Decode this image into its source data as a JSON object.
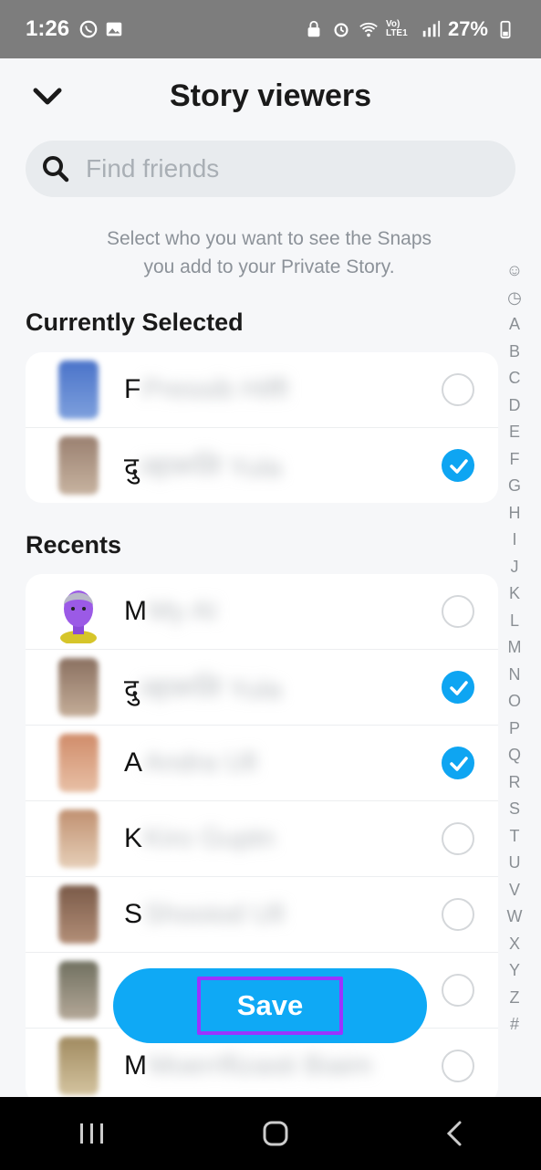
{
  "status": {
    "time": "1:26",
    "battery": "27%",
    "network_label": "Vo) LTE1"
  },
  "header": {
    "title": "Story viewers",
    "back_icon": "chevron-down-icon"
  },
  "search": {
    "placeholder": "Find friends"
  },
  "hint": {
    "line1": "Select who you want to see the Snaps",
    "line2": "you add to your Private Story."
  },
  "currently_selected": {
    "title": "Currently Selected",
    "items": [
      {
        "initial": "F",
        "rest": "Pressib Hiffl",
        "checked": false
      },
      {
        "initial": "दु",
        "rest": "ल्हारूलि Yula",
        "checked": true
      }
    ]
  },
  "recents": {
    "title": "Recents",
    "items": [
      {
        "initial": "M",
        "rest": "My AI",
        "checked": false
      },
      {
        "initial": "दु",
        "rest": "ल्हारूलि Yula",
        "checked": true
      },
      {
        "initial": "A",
        "rest": "Andra Ull",
        "checked": true
      },
      {
        "initial": "K",
        "rest": "Kiro Guptn",
        "checked": false
      },
      {
        "initial": "S",
        "rest": "Shooiod Ull",
        "checked": false
      },
      {
        "initial": "",
        "rest": "",
        "checked": false
      },
      {
        "initial": "M",
        "rest": "Moerrlfizasti Biaim",
        "checked": false
      }
    ]
  },
  "index_letters": [
    "☺",
    "◷",
    "A",
    "B",
    "C",
    "D",
    "E",
    "F",
    "G",
    "H",
    "I",
    "J",
    "K",
    "L",
    "M",
    "N",
    "O",
    "P",
    "Q",
    "R",
    "S",
    "T",
    "U",
    "V",
    "W",
    "X",
    "Y",
    "Z",
    "#"
  ],
  "save_button": {
    "label": "Save"
  },
  "colors": {
    "accent": "#0fa9f5",
    "highlight_box": "#9b33ff"
  }
}
